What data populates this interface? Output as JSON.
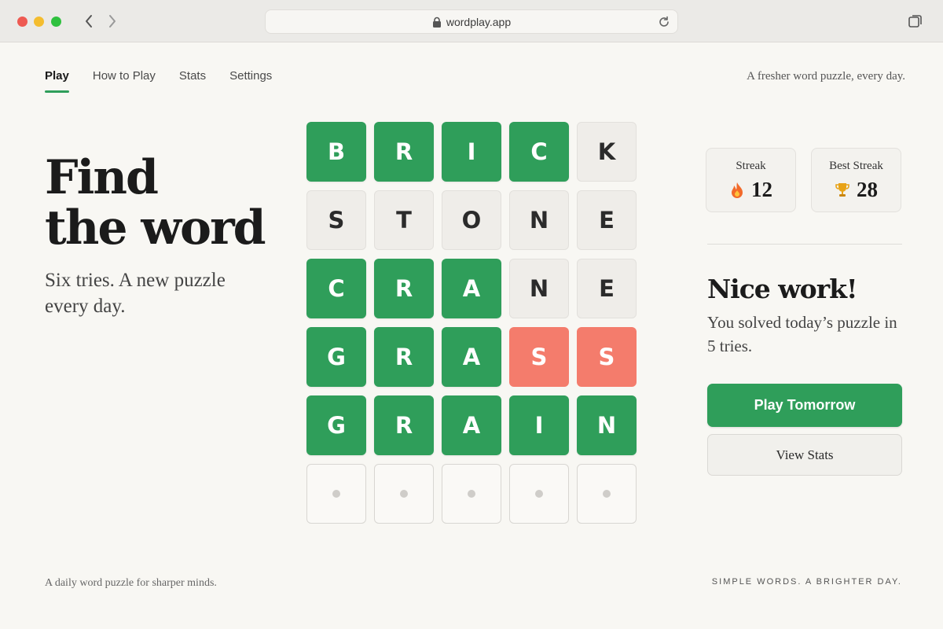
{
  "browser": {
    "url": "wordplay.app",
    "icons": {
      "back": "chevron-left-icon",
      "forward": "chevron-right-icon",
      "lock": "lock-icon",
      "reload": "reload-icon",
      "tabs": "tabs-icon"
    }
  },
  "nav": {
    "tabs": [
      {
        "label": "Play",
        "active": true
      },
      {
        "label": "How to Play",
        "active": false
      },
      {
        "label": "Stats",
        "active": false
      },
      {
        "label": "Settings",
        "active": false
      }
    ],
    "tagline": "A fresher word puzzle, every day."
  },
  "hero": {
    "title_line1": "Find",
    "title_line2": "the word",
    "subtitle": "Six tries. A new puzzle every day."
  },
  "board": {
    "rows": [
      [
        {
          "letter": "B",
          "state": "correct"
        },
        {
          "letter": "R",
          "state": "correct"
        },
        {
          "letter": "I",
          "state": "correct"
        },
        {
          "letter": "C",
          "state": "correct"
        },
        {
          "letter": "K",
          "state": "absent"
        }
      ],
      [
        {
          "letter": "S",
          "state": "absent"
        },
        {
          "letter": "T",
          "state": "absent"
        },
        {
          "letter": "O",
          "state": "absent"
        },
        {
          "letter": "N",
          "state": "absent"
        },
        {
          "letter": "E",
          "state": "absent"
        }
      ],
      [
        {
          "letter": "C",
          "state": "correct"
        },
        {
          "letter": "R",
          "state": "correct"
        },
        {
          "letter": "A",
          "state": "correct"
        },
        {
          "letter": "N",
          "state": "absent"
        },
        {
          "letter": "E",
          "state": "absent"
        }
      ],
      [
        {
          "letter": "G",
          "state": "correct"
        },
        {
          "letter": "R",
          "state": "correct"
        },
        {
          "letter": "A",
          "state": "correct"
        },
        {
          "letter": "S",
          "state": "wrong"
        },
        {
          "letter": "S",
          "state": "wrong"
        }
      ],
      [
        {
          "letter": "G",
          "state": "correct"
        },
        {
          "letter": "R",
          "state": "correct"
        },
        {
          "letter": "A",
          "state": "correct"
        },
        {
          "letter": "I",
          "state": "correct"
        },
        {
          "letter": "N",
          "state": "correct"
        }
      ],
      [
        {
          "letter": "",
          "state": "empty"
        },
        {
          "letter": "",
          "state": "empty"
        },
        {
          "letter": "",
          "state": "empty"
        },
        {
          "letter": "",
          "state": "empty"
        },
        {
          "letter": "",
          "state": "empty"
        }
      ]
    ],
    "colors": {
      "correct": "#2f9e5a",
      "absent": "#efede9",
      "wrong": "#f47c6c"
    }
  },
  "stats": {
    "streak": {
      "label": "Streak",
      "value": "12",
      "icon": "flame-icon"
    },
    "best_streak": {
      "label": "Best Streak",
      "value": "28",
      "icon": "trophy-icon"
    }
  },
  "result": {
    "title": "Nice work!",
    "text": "You solved today’s puzzle in 5 tries."
  },
  "actions": {
    "primary": "Play Tomorrow",
    "secondary": "View Stats"
  },
  "footer": {
    "left": "A daily word puzzle for sharper minds.",
    "right": "SIMPLE WORDS. A BRIGHTER DAY."
  }
}
